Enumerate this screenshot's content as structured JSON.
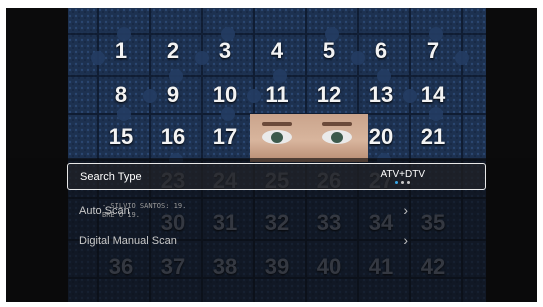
{
  "background": {
    "tile_numbers": [
      "1",
      "2",
      "3",
      "4",
      "5",
      "6",
      "7",
      "8",
      "9",
      "10",
      "11",
      "12",
      "13",
      "14",
      "15",
      "16",
      "17",
      "20",
      "21",
      "23",
      "24",
      "25",
      "26",
      "27",
      "30",
      "31",
      "32",
      "33",
      "34",
      "35",
      "36",
      "37",
      "38",
      "39",
      "40",
      "41",
      "42"
    ],
    "overlay_lines": [
      "- SILVIO SANTOS: 19.",
      "BRE O 19."
    ]
  },
  "menu": {
    "items": [
      {
        "label": "Search Type",
        "value": "ATV+DTV"
      },
      {
        "label": "Auto Scan"
      },
      {
        "label": "Digital Manual Scan"
      }
    ]
  }
}
